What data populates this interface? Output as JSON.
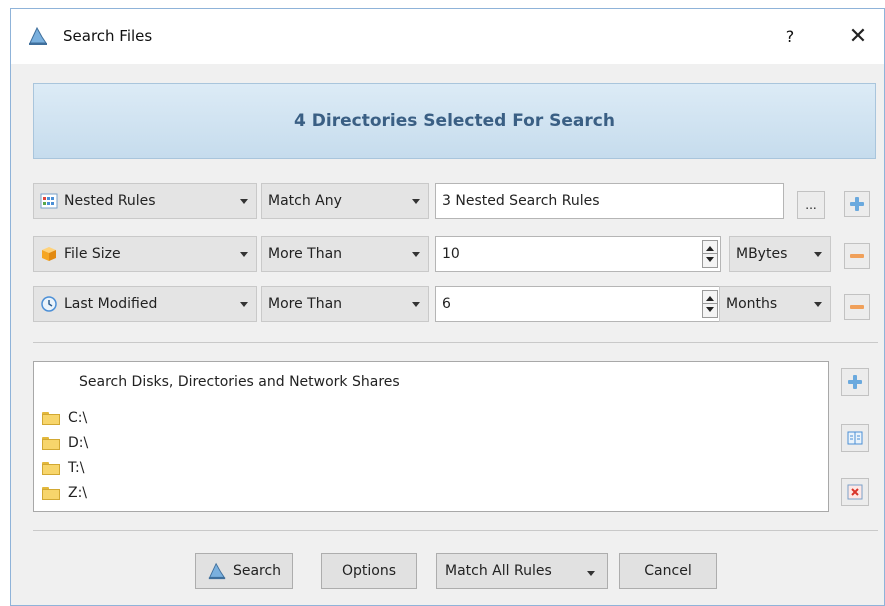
{
  "window": {
    "title": "Search Files",
    "help_label": "?",
    "close_label": "✕"
  },
  "banner": {
    "text": "4 Directories Selected For Search"
  },
  "rules": [
    {
      "type": "Nested Rules",
      "type_icon": "nested-rules-icon",
      "condition": "Match Any",
      "value": "3 Nested Search Rules",
      "browse_label": "...",
      "action": "add"
    },
    {
      "type": "File Size",
      "type_icon": "file-size-icon",
      "condition": "More Than",
      "value": "10",
      "unit": "MBytes",
      "action": "remove"
    },
    {
      "type": "Last Modified",
      "type_icon": "clock-icon",
      "condition": "More Than",
      "value": "6",
      "unit": "Months",
      "action": "remove"
    }
  ],
  "locations": {
    "header": "Search Disks, Directories and Network Shares",
    "items": [
      "C:\\",
      "D:\\",
      "T:\\",
      "Z:\\"
    ]
  },
  "buttons": {
    "search": "Search",
    "options": "Options",
    "match_mode": "Match All Rules",
    "cancel": "Cancel"
  },
  "colors": {
    "banner_text": "#3a5f84",
    "add_icon": "#6aa9de",
    "remove_icon": "#f0a05a"
  }
}
